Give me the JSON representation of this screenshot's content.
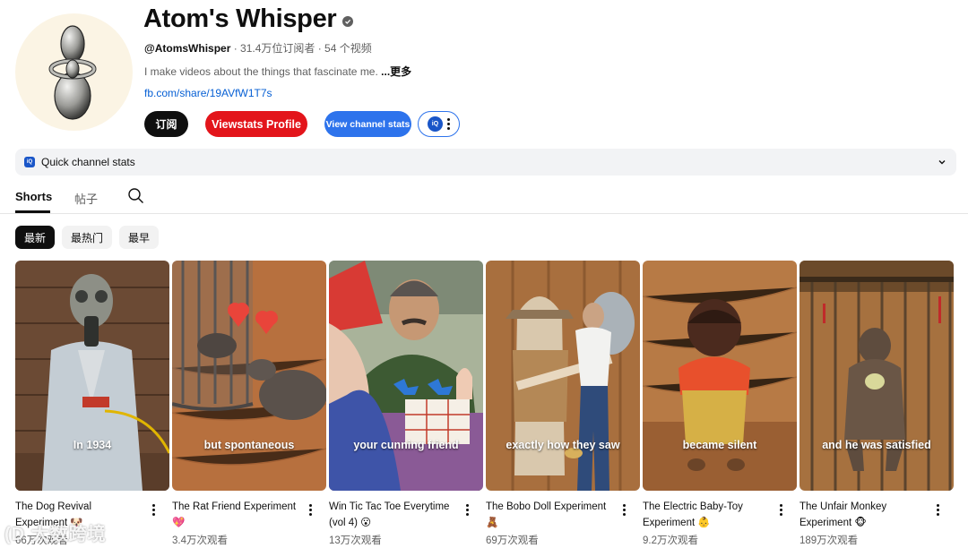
{
  "channel": {
    "name": "Atom's Whisper",
    "handle": "@AtomsWhisper",
    "stats": " · 31.4万位订阅者 · 54 个视频",
    "description": "I make videos about the things that fascinate me.",
    "more": " ...更多",
    "link": "fb.com/share/19AVfW1T7s"
  },
  "buttons": {
    "subscribe": "订阅",
    "viewstats": "Viewstats Profile",
    "view_stats": "View channel stats",
    "iq": "iQ"
  },
  "quick_stats": {
    "label": "Quick channel stats",
    "iq": "iQ"
  },
  "tabs": [
    {
      "label": "Shorts"
    },
    {
      "label": "帖子"
    }
  ],
  "chips": [
    {
      "label": "最新"
    },
    {
      "label": "最热门"
    },
    {
      "label": "最早"
    }
  ],
  "videos": [
    {
      "caption": "In 1934",
      "title_line1": "The Dog Revival",
      "title_line2": "Experiment 🐶",
      "views": "66万次观看"
    },
    {
      "caption": "but spontaneous",
      "title_line1": "The Rat Friend Experiment",
      "title_line2": "💖",
      "views": "3.4万次观看"
    },
    {
      "caption": "your cunning friend",
      "title_line1": "Win Tic Tac Toe Everytime",
      "title_line2": "(vol 4) 😮",
      "views": "13万次观看"
    },
    {
      "caption": "exactly how they saw",
      "title_line1": "The Bobo Doll Experiment",
      "title_line2": "🧸",
      "views": "69万次观看"
    },
    {
      "caption": "became silent",
      "title_line1": "The Electric Baby-Toy",
      "title_line2": "Experiment 👶",
      "views": "9.2万次观看"
    },
    {
      "caption": "and he was satisfied",
      "title_line1": "The Unfair Monkey",
      "title_line2": "Experiment 🐵",
      "views": "189万次观看"
    }
  ],
  "watermark": "(D 大数跨境"
}
